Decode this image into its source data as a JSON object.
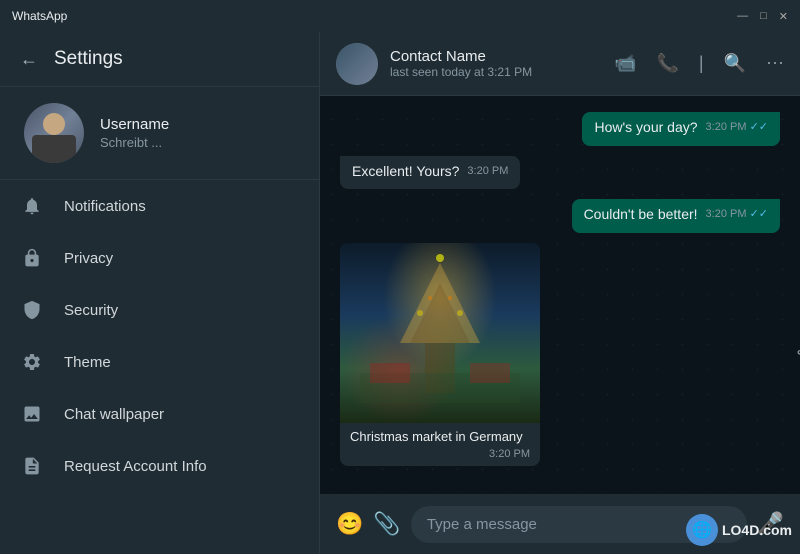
{
  "titlebar": {
    "title": "WhatsApp",
    "controls": {
      "minimize": "—",
      "maximize": "□",
      "close": "✕"
    }
  },
  "sidebar": {
    "back_label": "←",
    "settings_title": "Settings",
    "profile": {
      "name": "Username",
      "status": "Schreibt ..."
    },
    "menu_items": [
      {
        "id": "notifications",
        "label": "Notifications",
        "icon": "bell"
      },
      {
        "id": "privacy",
        "label": "Privacy",
        "icon": "lock"
      },
      {
        "id": "security",
        "label": "Security",
        "icon": "shield"
      },
      {
        "id": "theme",
        "label": "Theme",
        "icon": "gear"
      },
      {
        "id": "chat-wallpaper",
        "label": "Chat wallpaper",
        "icon": "image"
      },
      {
        "id": "request-account",
        "label": "Request Account Info",
        "icon": "doc"
      }
    ]
  },
  "chat": {
    "contact_name": "Contact Name",
    "last_seen": "last seen today at 3:21 PM",
    "messages": [
      {
        "id": 1,
        "type": "sent",
        "text": "How's your day?",
        "time": "3:20 PM",
        "ticks": "✓✓"
      },
      {
        "id": 2,
        "type": "received",
        "text": "Excellent! Yours?",
        "time": "3:20 PM"
      },
      {
        "id": 3,
        "type": "sent",
        "text": "Couldn't be better!",
        "time": "3:20 PM",
        "ticks": "✓✓"
      },
      {
        "id": 4,
        "type": "image",
        "caption": "Christmas market in Germany",
        "time": "3:20 PM"
      }
    ],
    "input_placeholder": "Type a message"
  },
  "watermark": {
    "text": "LO4D.com",
    "logo": "🌐"
  }
}
